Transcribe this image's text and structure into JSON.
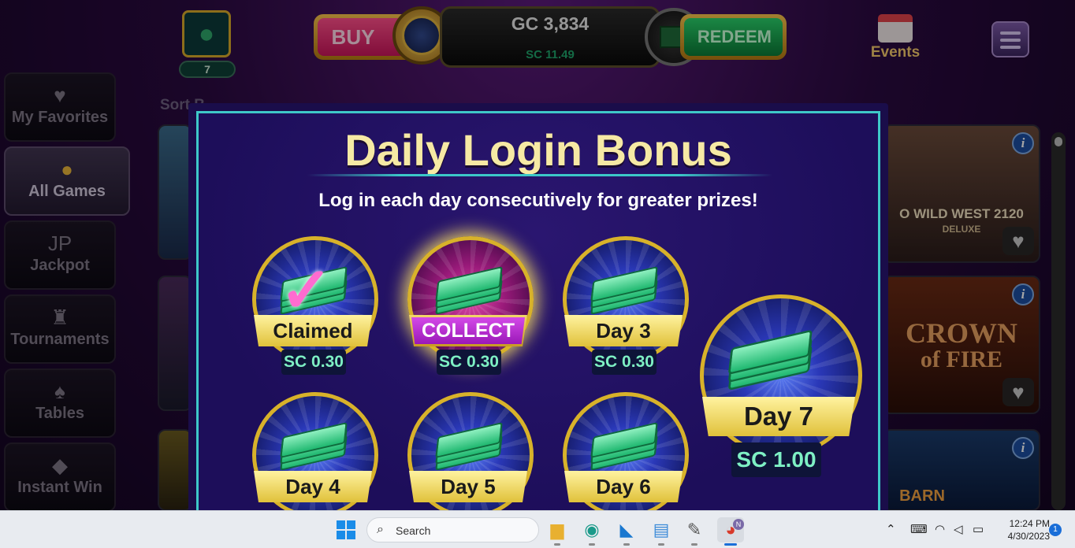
{
  "topbar": {
    "level": "7",
    "buy_label": "BUY",
    "gc_balance": "GC 3,834",
    "sc_balance": "SC 11.49",
    "redeem_label": "REDEEM",
    "events_label": "Events"
  },
  "sidebar": {
    "items": [
      {
        "label": "My Favorites",
        "icon": "heart-icon",
        "glyph": "♥"
      },
      {
        "label": "All Games",
        "icon": "coins-icon",
        "glyph": "●"
      },
      {
        "label": "Jackpot",
        "icon": "jackpot-icon",
        "glyph": "JP"
      },
      {
        "label": "Tournaments",
        "icon": "trophy-icon",
        "glyph": "♜"
      },
      {
        "label": "Tables",
        "icon": "cards-icon",
        "glyph": "♠"
      },
      {
        "label": "Instant Win",
        "icon": "diamond-icon",
        "glyph": "◆"
      }
    ],
    "sort_label": "Sort B"
  },
  "games": {
    "tile1_title": "O WILD WEST 2120",
    "tile1_sub": "DELUXE",
    "tile2_title": "CROWN",
    "tile2_sub": "of FIRE",
    "tile3_title": "BARN"
  },
  "modal": {
    "title": "Daily Login Bonus",
    "subtitle": "Log in each day consecutively for greater prizes!",
    "days": [
      {
        "label": "Claimed",
        "prize": "SC 0.30"
      },
      {
        "label": "COLLECT",
        "prize": "SC 0.30"
      },
      {
        "label": "Day 3",
        "prize": "SC 0.30"
      },
      {
        "label": "Day 4",
        "prize": ""
      },
      {
        "label": "Day 5",
        "prize": ""
      },
      {
        "label": "Day 6",
        "prize": ""
      },
      {
        "label": "Day 7",
        "prize": "SC 1.00"
      }
    ]
  },
  "taskbar": {
    "search_placeholder": "Search",
    "time": "12:24 PM",
    "date": "4/30/2023",
    "notifications": "1",
    "chrome_badge": "N"
  },
  "colors": {
    "accent_gold": "#d8b22a",
    "title_text": "#f6e9a4",
    "prize_text": "#7ef0c4",
    "collect_purple": "#b62ad4"
  }
}
